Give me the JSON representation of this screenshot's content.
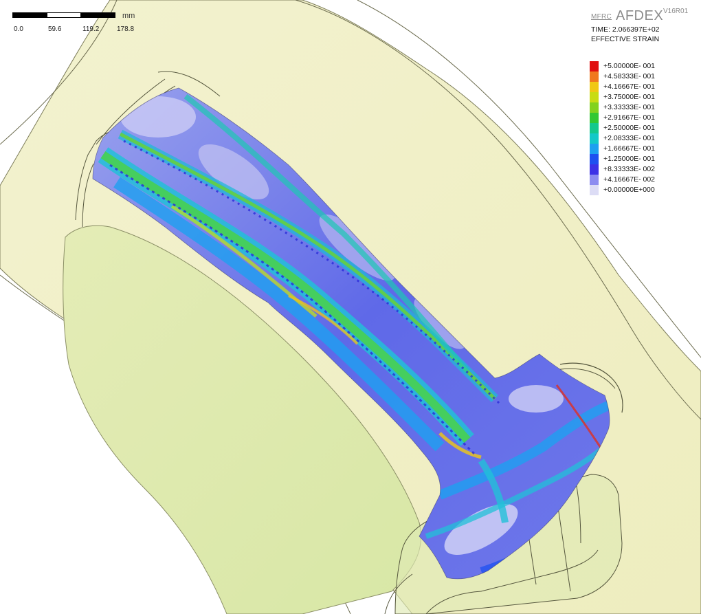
{
  "header": {
    "logo_prefix": "MFRC",
    "logo_main": "AFDEX",
    "logo_version": "V16R01",
    "time_text": "TIME: 2.066397E+02",
    "variable_text": "EFFECTIVE STRAIN"
  },
  "scale_bar": {
    "unit": "mm",
    "ticks": [
      "0.0",
      "59.6",
      "119.2",
      "178.8"
    ]
  },
  "legend": {
    "entries": [
      {
        "label": "+5.00000E- 001",
        "color": "#e01010"
      },
      {
        "label": "+4.58333E- 001",
        "color": "#f0781e"
      },
      {
        "label": "+4.16667E- 001",
        "color": "#f0c814"
      },
      {
        "label": "+3.75000E- 001",
        "color": "#c8dc14"
      },
      {
        "label": "+3.33333E- 001",
        "color": "#82d21e"
      },
      {
        "label": "+2.91667E- 001",
        "color": "#32c832"
      },
      {
        "label": "+2.50000E- 001",
        "color": "#14c88c"
      },
      {
        "label": "+2.08333E- 001",
        "color": "#14c8c8"
      },
      {
        "label": "+1.66667E- 001",
        "color": "#1ea0f0"
      },
      {
        "label": "+1.25000E- 001",
        "color": "#1e50f0"
      },
      {
        "label": "+8.33333E- 002",
        "color": "#3c32e6"
      },
      {
        "label": "+4.16667E- 002",
        "color": "#8c8cf0"
      },
      {
        "label": "+0.00000E+000",
        "color": "#dcdcf5"
      }
    ]
  }
}
